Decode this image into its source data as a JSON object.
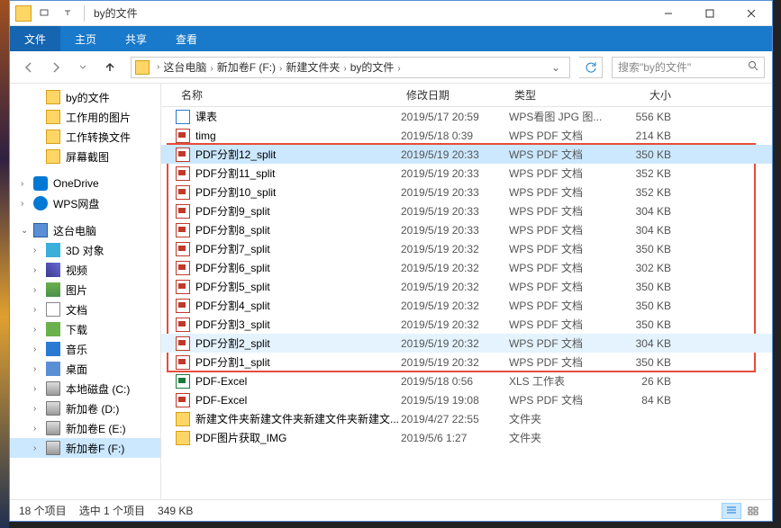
{
  "window": {
    "title": "by的文件"
  },
  "ribbon": {
    "file": "文件",
    "home": "主页",
    "share": "共享",
    "view": "查看"
  },
  "breadcrumb": {
    "items": [
      "这台电脑",
      "新加卷F (F:)",
      "新建文件夹",
      "by的文件"
    ]
  },
  "search": {
    "placeholder": "搜索\"by的文件\""
  },
  "sidebar": {
    "items": [
      {
        "label": "by的文件",
        "icon": "folder-ico",
        "indent": 26
      },
      {
        "label": "工作用的图片",
        "icon": "folder-ico",
        "indent": 26
      },
      {
        "label": "工作转换文件",
        "icon": "folder-ico",
        "indent": 26
      },
      {
        "label": "屏幕截图",
        "icon": "folder-ico",
        "indent": 26
      },
      {
        "sep": true
      },
      {
        "label": "OneDrive",
        "icon": "onedrive-ico",
        "indent": 12,
        "expand": ">"
      },
      {
        "label": "WPS网盘",
        "icon": "wps-ico",
        "indent": 12,
        "expand": ">"
      },
      {
        "sep": true
      },
      {
        "label": "这台电脑",
        "icon": "pc-ico",
        "indent": 12,
        "expand": "v"
      },
      {
        "label": "3D 对象",
        "icon": "obj3d-ico",
        "indent": 26,
        "expand": ">"
      },
      {
        "label": "视频",
        "icon": "video-ico",
        "indent": 26,
        "expand": ">"
      },
      {
        "label": "图片",
        "icon": "pic-ico",
        "indent": 26,
        "expand": ">"
      },
      {
        "label": "文档",
        "icon": "doc-ico",
        "indent": 26,
        "expand": ">"
      },
      {
        "label": "下载",
        "icon": "down-ico",
        "indent": 26,
        "expand": ">"
      },
      {
        "label": "音乐",
        "icon": "music-ico",
        "indent": 26,
        "expand": ">"
      },
      {
        "label": "桌面",
        "icon": "desk-ico",
        "indent": 26,
        "expand": ">"
      },
      {
        "label": "本地磁盘 (C:)",
        "icon": "drive-ico",
        "indent": 26,
        "expand": ">"
      },
      {
        "label": "新加卷 (D:)",
        "icon": "drive-ico",
        "indent": 26,
        "expand": ">"
      },
      {
        "label": "新加卷E (E:)",
        "icon": "drive-ico",
        "indent": 26,
        "expand": ">"
      },
      {
        "label": "新加卷F (F:)",
        "icon": "drive-ico",
        "indent": 26,
        "expand": ">",
        "selected": true
      }
    ]
  },
  "columns": {
    "name": "名称",
    "date": "修改日期",
    "type": "类型",
    "size": "大小"
  },
  "files": [
    {
      "name": "课表",
      "date": "2019/5/17 20:59",
      "type": "WPS看图 JPG 图...",
      "size": "556 KB",
      "icon": "jpg-ico"
    },
    {
      "name": "timg",
      "date": "2019/5/18 0:39",
      "type": "WPS PDF 文档",
      "size": "214 KB",
      "icon": "pdf-ico"
    },
    {
      "name": "PDF分割12_split",
      "date": "2019/5/19 20:33",
      "type": "WPS PDF 文档",
      "size": "350 KB",
      "icon": "pdf-ico",
      "selected": true
    },
    {
      "name": "PDF分割11_split",
      "date": "2019/5/19 20:33",
      "type": "WPS PDF 文档",
      "size": "352 KB",
      "icon": "pdf-ico"
    },
    {
      "name": "PDF分割10_split",
      "date": "2019/5/19 20:33",
      "type": "WPS PDF 文档",
      "size": "352 KB",
      "icon": "pdf-ico"
    },
    {
      "name": "PDF分割9_split",
      "date": "2019/5/19 20:33",
      "type": "WPS PDF 文档",
      "size": "304 KB",
      "icon": "pdf-ico"
    },
    {
      "name": "PDF分割8_split",
      "date": "2019/5/19 20:33",
      "type": "WPS PDF 文档",
      "size": "304 KB",
      "icon": "pdf-ico"
    },
    {
      "name": "PDF分割7_split",
      "date": "2019/5/19 20:32",
      "type": "WPS PDF 文档",
      "size": "350 KB",
      "icon": "pdf-ico"
    },
    {
      "name": "PDF分割6_split",
      "date": "2019/5/19 20:32",
      "type": "WPS PDF 文档",
      "size": "302 KB",
      "icon": "pdf-ico"
    },
    {
      "name": "PDF分割5_split",
      "date": "2019/5/19 20:32",
      "type": "WPS PDF 文档",
      "size": "350 KB",
      "icon": "pdf-ico"
    },
    {
      "name": "PDF分割4_split",
      "date": "2019/5/19 20:32",
      "type": "WPS PDF 文档",
      "size": "350 KB",
      "icon": "pdf-ico"
    },
    {
      "name": "PDF分割3_split",
      "date": "2019/5/19 20:32",
      "type": "WPS PDF 文档",
      "size": "350 KB",
      "icon": "pdf-ico"
    },
    {
      "name": "PDF分割2_split",
      "date": "2019/5/19 20:32",
      "type": "WPS PDF 文档",
      "size": "304 KB",
      "icon": "pdf-ico",
      "hover": true
    },
    {
      "name": "PDF分割1_split",
      "date": "2019/5/19 20:32",
      "type": "WPS PDF 文档",
      "size": "350 KB",
      "icon": "pdf-ico"
    },
    {
      "name": "PDF-Excel",
      "date": "2019/5/18 0:56",
      "type": "XLS 工作表",
      "size": "26 KB",
      "icon": "xls-ico"
    },
    {
      "name": "PDF-Excel",
      "date": "2019/5/19 19:08",
      "type": "WPS PDF 文档",
      "size": "84 KB",
      "icon": "pdf-ico"
    },
    {
      "name": "新建文件夹新建文件夹新建文件夹新建文...",
      "date": "2019/4/27 22:55",
      "type": "文件夹",
      "size": "",
      "icon": "fld-ico"
    },
    {
      "name": "PDF图片获取_IMG",
      "date": "2019/5/6 1:27",
      "type": "文件夹",
      "size": "",
      "icon": "fld-ico"
    }
  ],
  "status": {
    "count": "18 个项目",
    "selected": "选中 1 个项目",
    "size": "349 KB"
  }
}
